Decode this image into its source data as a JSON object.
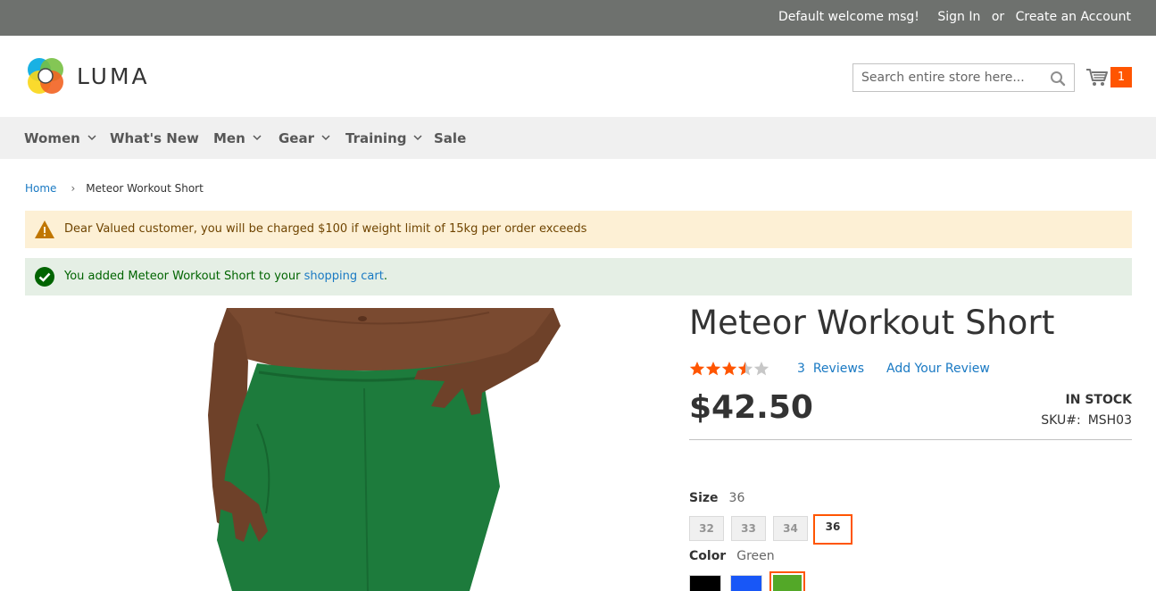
{
  "topbar": {
    "welcome": "Default welcome msg!",
    "sign_in": "Sign In",
    "or": "or",
    "create_account": "Create an Account"
  },
  "header": {
    "logo_text": "LUMA",
    "search_placeholder": "Search entire store here...",
    "cart_count": "1"
  },
  "nav": {
    "items": [
      {
        "label": "Women",
        "has_dropdown": true
      },
      {
        "label": "What's New",
        "has_dropdown": false
      },
      {
        "label": "Men",
        "has_dropdown": true
      },
      {
        "label": "Gear",
        "has_dropdown": true
      },
      {
        "label": "Training",
        "has_dropdown": true
      },
      {
        "label": "Sale",
        "has_dropdown": false
      }
    ]
  },
  "breadcrumb": {
    "home": "Home",
    "separator": "›",
    "current": "Meteor Workout Short"
  },
  "messages": {
    "warning": "Dear Valued customer, you will be charged $100 if weight limit of 15kg per order exceeds",
    "success_prefix": "You added Meteor Workout Short to your ",
    "success_link": "shopping cart",
    "success_suffix": "."
  },
  "product": {
    "name": "Meteor Workout Short",
    "rating_fraction": 0.7,
    "reviews_count": "3",
    "reviews_label": "Reviews",
    "add_review": "Add Your Review",
    "price": "$42.50",
    "stock": "IN STOCK",
    "sku_label": "SKU#:",
    "sku": "MSH03",
    "size": {
      "label": "Size",
      "selected": "36",
      "options": [
        "32",
        "33",
        "34",
        "36"
      ]
    },
    "color": {
      "label": "Color",
      "selected": "Green",
      "options": [
        {
          "name": "Black",
          "hex": "#000000"
        },
        {
          "name": "Blue",
          "hex": "#1857f7"
        },
        {
          "name": "Green",
          "hex": "#53a828"
        }
      ]
    }
  },
  "colors": {
    "accent": "#ff5501",
    "link": "#1979c3",
    "topbar": "#6e716e",
    "nav_bg": "#f0f0f0"
  }
}
